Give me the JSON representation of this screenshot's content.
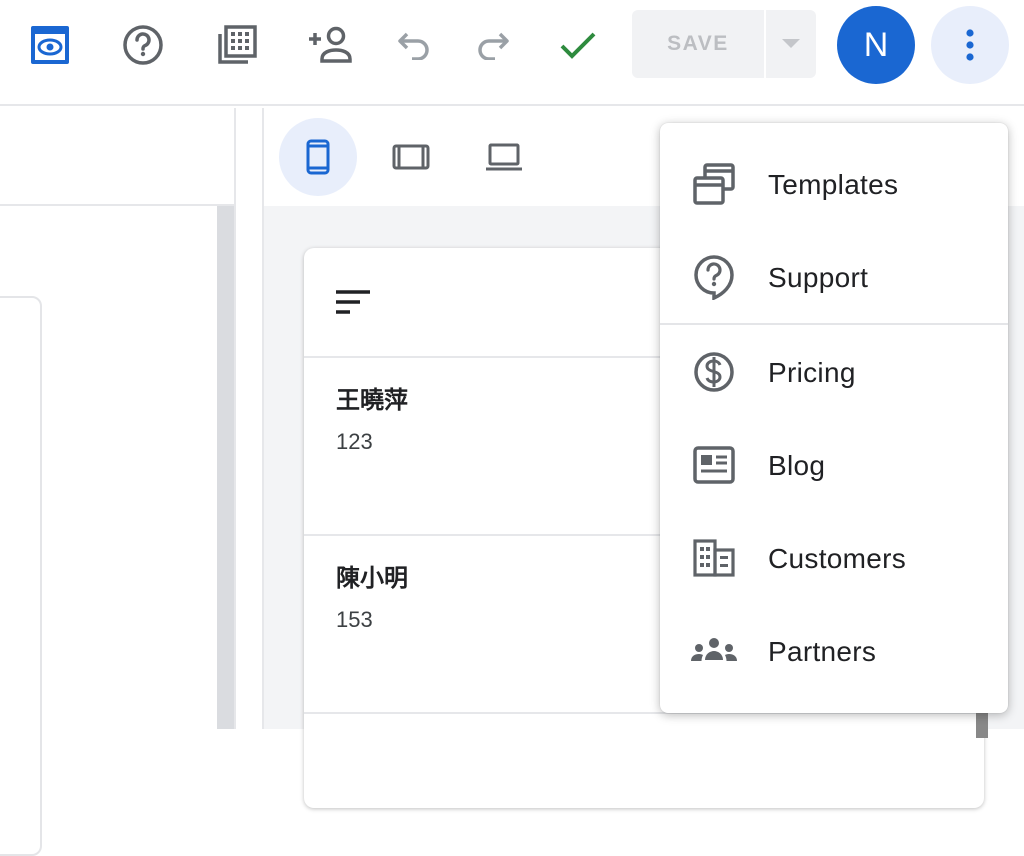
{
  "toolbar": {
    "icons": [
      "preview-icon",
      "help-icon",
      "spreadsheet-icon",
      "add-person-icon",
      "undo-icon",
      "redo-icon",
      "check-icon"
    ],
    "save_label": "SAVE",
    "avatar_letter": "N",
    "accent_color": "#1a67d2",
    "check_color": "#2e8b3e"
  },
  "devices": {
    "items": [
      "phone-icon",
      "tablet-icon",
      "laptop-icon"
    ],
    "selected": "phone-icon"
  },
  "preview": {
    "records": [
      {
        "name": "王曉萍",
        "value": "123"
      },
      {
        "name": "陳小明",
        "value": "153"
      }
    ]
  },
  "menu": {
    "items": [
      {
        "label": "Templates",
        "icon": "templates-icon"
      },
      {
        "label": "Support",
        "icon": "support-icon"
      },
      {
        "label": "Pricing",
        "icon": "pricing-icon"
      },
      {
        "label": "Blog",
        "icon": "blog-icon"
      },
      {
        "label": "Customers",
        "icon": "customers-icon"
      },
      {
        "label": "Partners",
        "icon": "partners-icon"
      }
    ]
  }
}
